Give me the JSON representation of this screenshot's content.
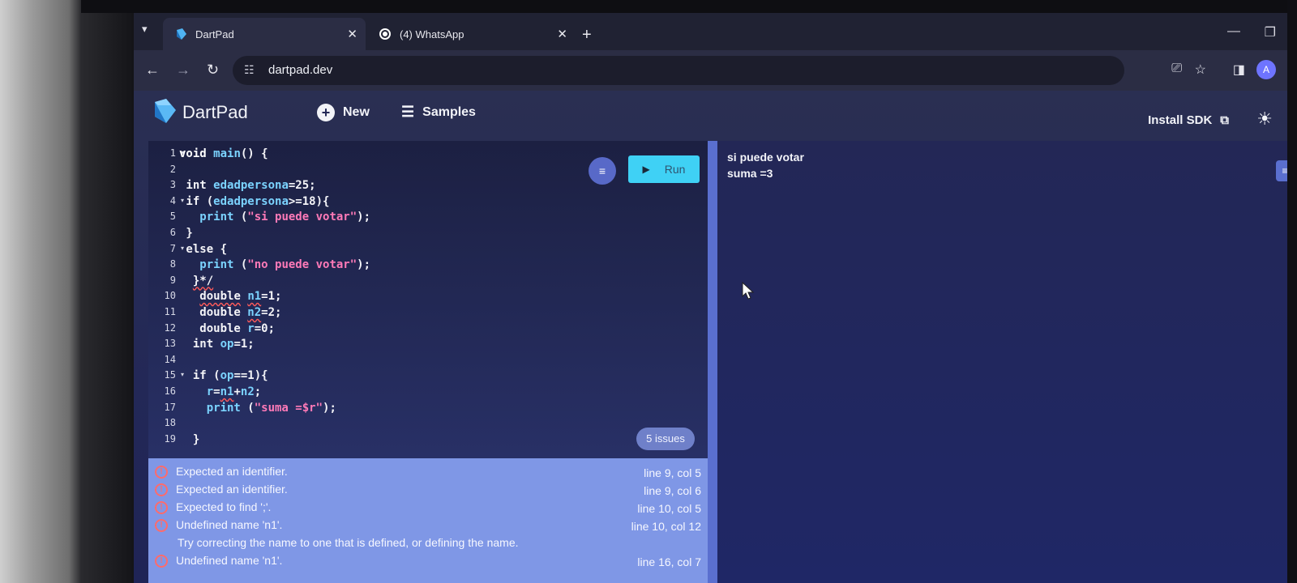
{
  "browser": {
    "tabs": [
      {
        "title": "DartPad",
        "active": true
      },
      {
        "title": "(4) WhatsApp",
        "active": false
      }
    ],
    "url": "dartpad.dev",
    "avatar_letter": "A"
  },
  "app": {
    "title": "DartPad",
    "new_label": "New",
    "samples_label": "Samples",
    "install_label": "Install SDK",
    "run_label": "Run",
    "issues_label": "5 issues"
  },
  "editor": {
    "line_numbers": [
      "1",
      "2",
      "3",
      "4",
      "5",
      "6",
      "7",
      "8",
      "9",
      "10",
      "11",
      "12",
      "13",
      "14",
      "15",
      "16",
      "17",
      "18",
      "19"
    ]
  },
  "problems": [
    {
      "message": "Expected an identifier.",
      "location": "line 9, col 5"
    },
    {
      "message": "Expected an identifier.",
      "location": "line 9, col 6"
    },
    {
      "message": "Expected to find ';'.",
      "location": "line 10, col 5"
    },
    {
      "message": "Undefined name 'n1'.",
      "location": "line 10, col 12"
    },
    {
      "message": "Undefined name 'n1'.",
      "location": "line 16, col 7"
    }
  ],
  "problem_hint": "Try correcting the name to one that is defined, or defining the name.",
  "output": {
    "lines": [
      "si puede votar",
      "suma =3"
    ]
  },
  "colors": {
    "run_button": "#3fd1f5",
    "error": "#ff6b6b",
    "problems_bg": "#7f97e6",
    "accent": "#5a6fcf"
  }
}
